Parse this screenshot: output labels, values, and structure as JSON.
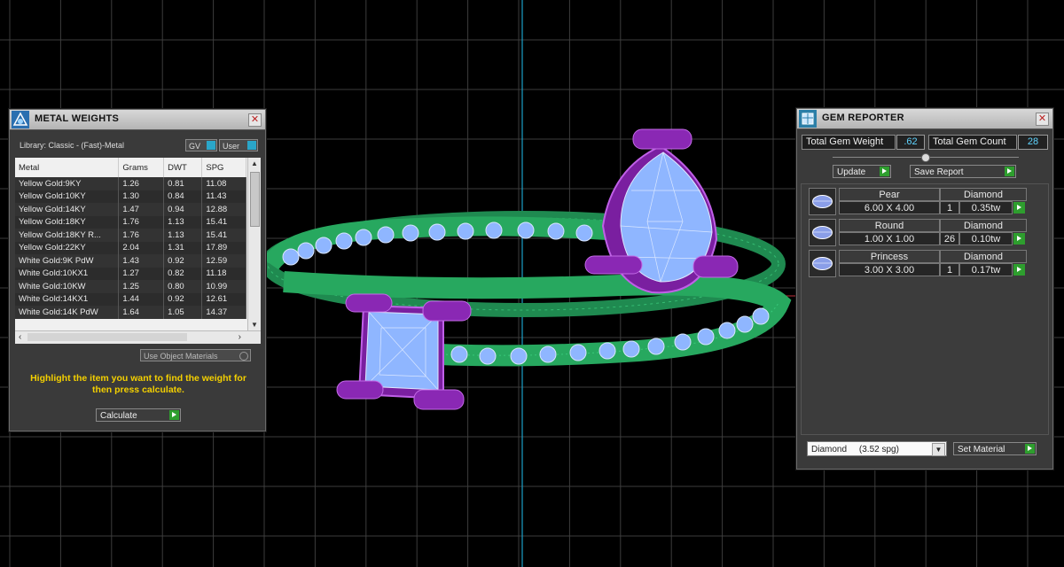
{
  "metal_weights": {
    "title": "METAL WEIGHTS",
    "library": "Library: Classic - (Fast)-Metal",
    "gv_label": "GV",
    "user_label": "User",
    "columns": [
      "Metal",
      "Grams",
      "DWT",
      "SPG"
    ],
    "rows": [
      [
        "Yellow Gold:9KY",
        "1.26",
        "0.81",
        "11.08"
      ],
      [
        "Yellow Gold:10KY",
        "1.30",
        "0.84",
        "11.43"
      ],
      [
        "Yellow Gold:14KY",
        "1.47",
        "0.94",
        "12.88"
      ],
      [
        "Yellow Gold:18KY",
        "1.76",
        "1.13",
        "15.41"
      ],
      [
        "Yellow Gold:18KY R...",
        "1.76",
        "1.13",
        "15.41"
      ],
      [
        "Yellow Gold:22KY",
        "2.04",
        "1.31",
        "17.89"
      ],
      [
        "White Gold:9K PdW",
        "1.43",
        "0.92",
        "12.59"
      ],
      [
        "White Gold:10KX1",
        "1.27",
        "0.82",
        "11.18"
      ],
      [
        "White Gold:10KW",
        "1.25",
        "0.80",
        "10.99"
      ],
      [
        "White Gold:14KX1",
        "1.44",
        "0.92",
        "12.61"
      ],
      [
        "White Gold:14K PdW",
        "1.64",
        "1.05",
        "14.37"
      ]
    ],
    "use_object_materials": "Use Object Materials",
    "hint": "Highlight the item you want to find the weight for then press calculate.",
    "calculate": "Calculate"
  },
  "gem_reporter": {
    "title": "GEM REPORTER",
    "total_weight_label": "Total Gem Weight",
    "total_weight": ".62",
    "total_count_label": "Total Gem Count",
    "total_count": "28",
    "update": "Update",
    "save_report": "Save Report",
    "gems": [
      {
        "shape": "Pear",
        "size": "6.00 X 4.00",
        "material": "Diamond",
        "count": "1",
        "weight": "0.35tw"
      },
      {
        "shape": "Round",
        "size": "1.00 X 1.00",
        "material": "Diamond",
        "count": "26",
        "weight": "0.10tw"
      },
      {
        "shape": "Princess",
        "size": "3.00 X 3.00",
        "material": "Diamond",
        "count": "1",
        "weight": "0.17tw"
      }
    ],
    "material_select": "Diamond     (3.52 spg)",
    "set_material": "Set Material"
  },
  "colors": {
    "grid": "#3d3d3d",
    "shank": "#2db86a",
    "gem": "#8fb6ff",
    "prong": "#9a2fc0",
    "axis": "#1aa0c8"
  }
}
